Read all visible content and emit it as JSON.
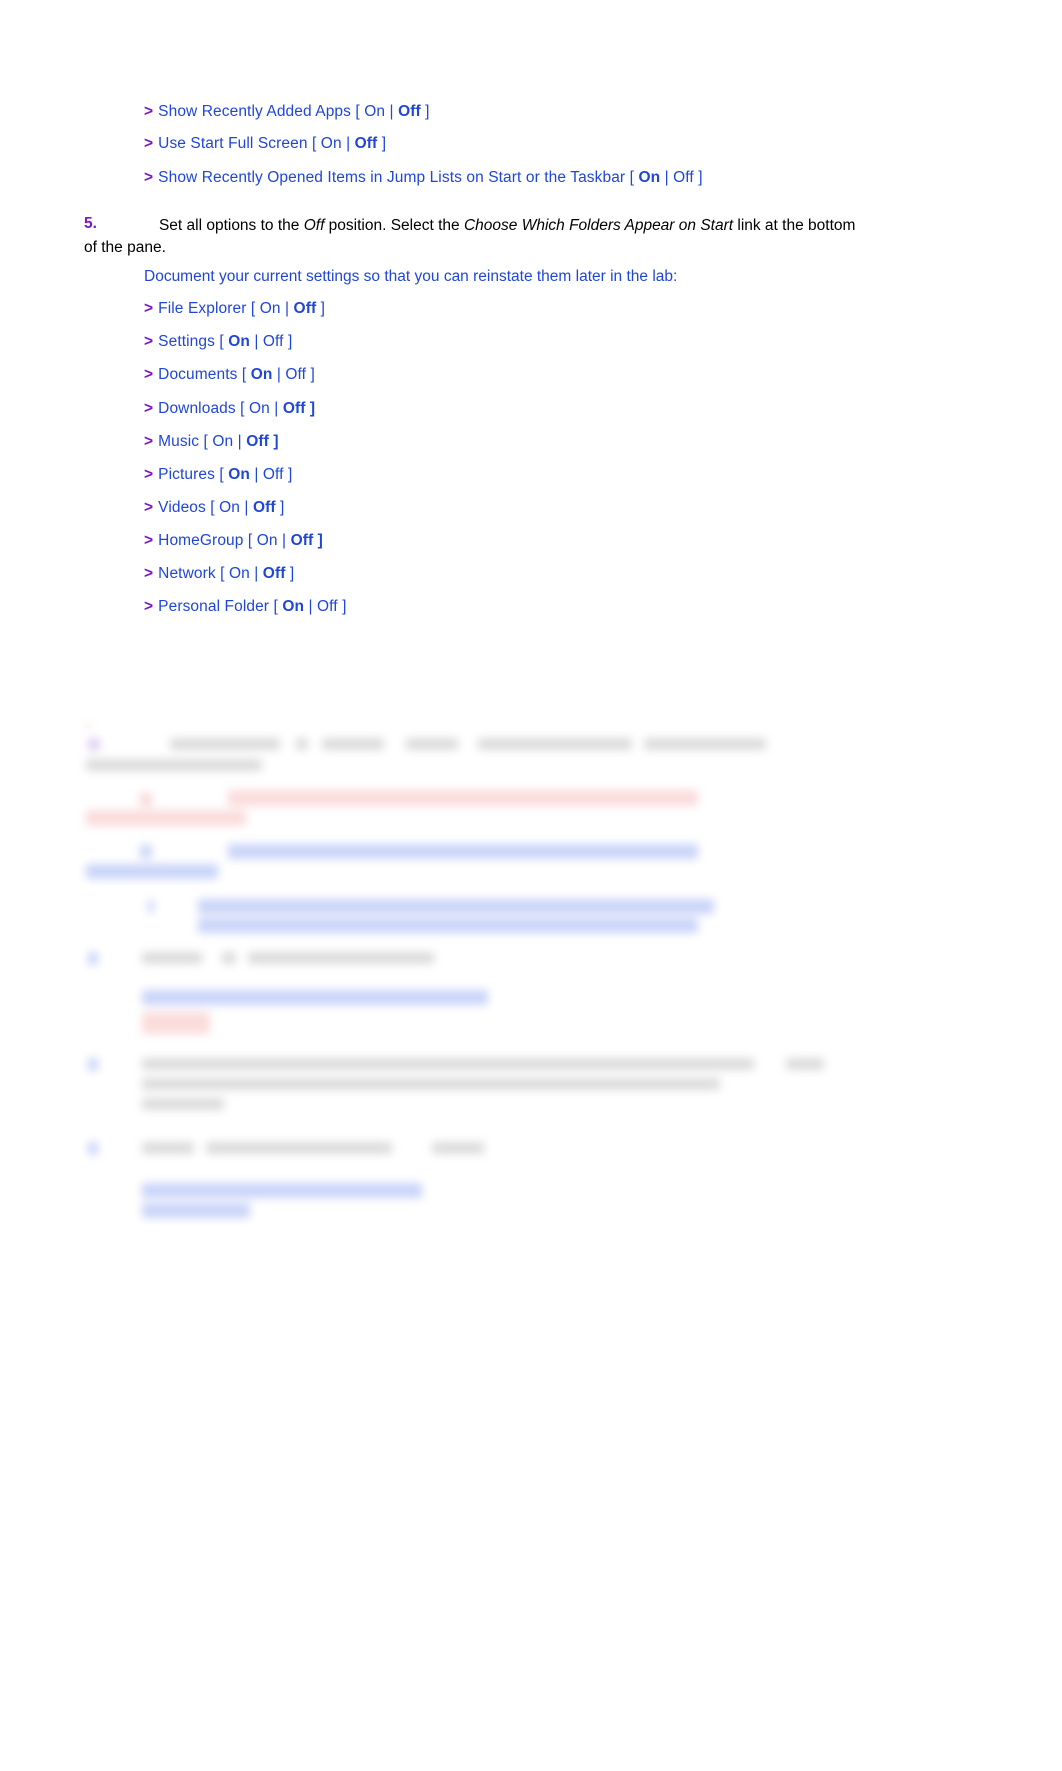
{
  "document": {
    "page_background": "#ffffff",
    "body_text_color": "#000000",
    "link_text_color": "#2046d8",
    "marker_color": "#7b16c4"
  },
  "top_options": {
    "marker": ">",
    "items": [
      {
        "label": "Show Recently Added Apps",
        "open_bracket": "[",
        "on": "On",
        "sep": "|",
        "off": "Off",
        "close_bracket": "]",
        "bold": "off",
        "bold_bracket": false
      },
      {
        "label": "Use Start Full Screen",
        "open_bracket": "[",
        "on": "On",
        "sep": "|",
        "off": "Off",
        "close_bracket": "]",
        "bold": "off",
        "bold_bracket": false
      },
      {
        "label": "Show Recently Opened Items in Jump Lists on Start or the Taskbar",
        "open_bracket": "[",
        "on": "On",
        "sep": "|",
        "off": "Off",
        "close_bracket": "]",
        "bold": "on",
        "bold_bracket": false
      }
    ]
  },
  "step5": {
    "number": "5.",
    "text_part1": "Set all options to the ",
    "italic1": "Off",
    "text_part2": " position. Select the ",
    "italic2": "Choose Which Folders Appear on Start",
    "text_part3": " link at the bottom of the pane."
  },
  "documentation_note": "Document your current settings so that you can reinstate them later in the lab:",
  "folder_options": {
    "marker": ">",
    "items": [
      {
        "label": "File Explorer",
        "on": "On",
        "off": "Off",
        "bold": "off",
        "bold_bracket": false
      },
      {
        "label": "Settings",
        "on": "On",
        "off": "Off",
        "bold": "on",
        "bold_bracket": false
      },
      {
        "label": "Documents",
        "on": "On",
        "off": "Off",
        "bold": "on",
        "bold_bracket": false
      },
      {
        "label": "Downloads",
        "on": "On",
        "off": "Off",
        "bold": "off",
        "bold_bracket": true
      },
      {
        "label": "Music",
        "on": "On",
        "off": "Off",
        "bold": "off",
        "bold_bracket": true
      },
      {
        "label": "Pictures",
        "on": "On",
        "off": "Off",
        "bold": "on",
        "bold_bracket": false
      },
      {
        "label": "Videos",
        "on": "On",
        "off": "Off",
        "bold": "off",
        "bold_bracket": false
      },
      {
        "label": "HomeGroup",
        "on": "On",
        "off": "Off",
        "bold": "off",
        "bold_bracket": true
      },
      {
        "label": "Network",
        "on": "On",
        "off": "Off",
        "bold": "off",
        "bold_bracket": false
      },
      {
        "label": "Personal Folder",
        "on": "On",
        "off": "Off",
        "bold": "on",
        "bold_bracket": false
      }
    ],
    "open_bracket": "[",
    "separator": "|",
    "close_bracket": "]"
  },
  "obscured_section": {
    "note": "Lower portion of the page is blurred and illegible in the screenshot; no readable text is present.",
    "visible_colors": [
      "#8a8a8a",
      "#3d63e8",
      "#e04848",
      "#8a3fd0",
      "#f08a8a"
    ]
  }
}
